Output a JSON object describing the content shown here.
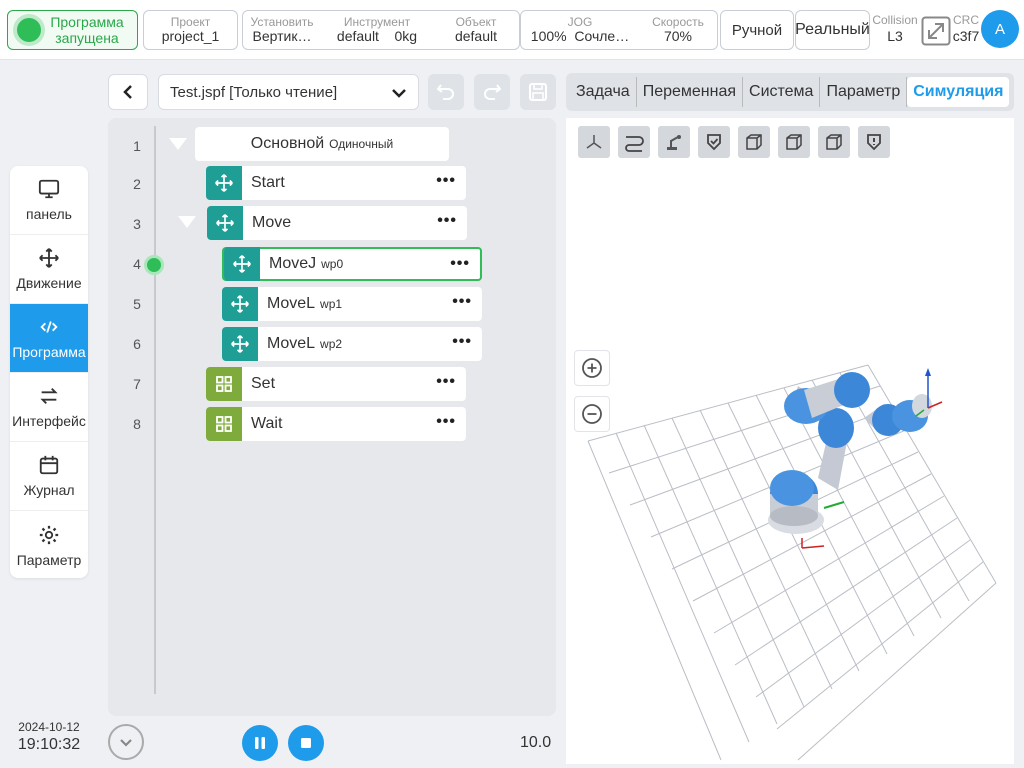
{
  "topbar": {
    "status": "Программа запущена",
    "project": {
      "label": "Проект",
      "value": "project_1"
    },
    "install": {
      "label": "Установить",
      "value": "Вертик…"
    },
    "tool": {
      "label": "Инструмент",
      "value": "default",
      "load": "0kg"
    },
    "object": {
      "label": "Объект",
      "value": "default"
    },
    "jog": {
      "label": "JOG",
      "value": "100%",
      "mode": "Сочле…"
    },
    "speed": {
      "label": "Скорость",
      "value": "70%"
    },
    "manual": "Ручной",
    "real": "Реальный",
    "collision": {
      "label": "Collision",
      "value": "L3"
    },
    "crc": {
      "label": "CRC",
      "value": "c3f7"
    },
    "avatar": "A"
  },
  "sidebar": {
    "items": [
      {
        "label": "панель",
        "icon": "monitor-icon"
      },
      {
        "label": "Движение",
        "icon": "move-icon"
      },
      {
        "label": "Программа",
        "icon": "code-icon",
        "active": true
      },
      {
        "label": "Интерфейс",
        "icon": "swap-icon"
      },
      {
        "label": "Журнал",
        "icon": "calendar-icon"
      },
      {
        "label": "Параметр",
        "icon": "gear-icon"
      }
    ]
  },
  "datetime": {
    "date": "2024-10-12",
    "time": "19:10:32"
  },
  "program": {
    "file": "Test.jspf [Только чтение]",
    "root": {
      "label": "Основной",
      "sub": "Одиночный"
    },
    "lines": [
      "1",
      "2",
      "3",
      "4",
      "5",
      "6",
      "7",
      "8"
    ],
    "nodes": [
      {
        "label": "Start",
        "sub": ""
      },
      {
        "label": "Move",
        "sub": ""
      },
      {
        "label": "MoveJ",
        "sub": "wp0"
      },
      {
        "label": "MoveL",
        "sub": "wp1"
      },
      {
        "label": "MoveL",
        "sub": "wp2"
      },
      {
        "label": "Set",
        "sub": ""
      },
      {
        "label": "Wait",
        "sub": ""
      }
    ],
    "speed_factor": "10.0"
  },
  "tabs": [
    {
      "label": "Задача"
    },
    {
      "label": "Переменная"
    },
    {
      "label": "Система"
    },
    {
      "label": "Параметр"
    },
    {
      "label": "Симуляция",
      "active": true
    }
  ],
  "colors": {
    "accent": "#1e9bea",
    "run": "#2fbd58",
    "teal": "#1f9e95",
    "olive": "#7fab3c"
  }
}
